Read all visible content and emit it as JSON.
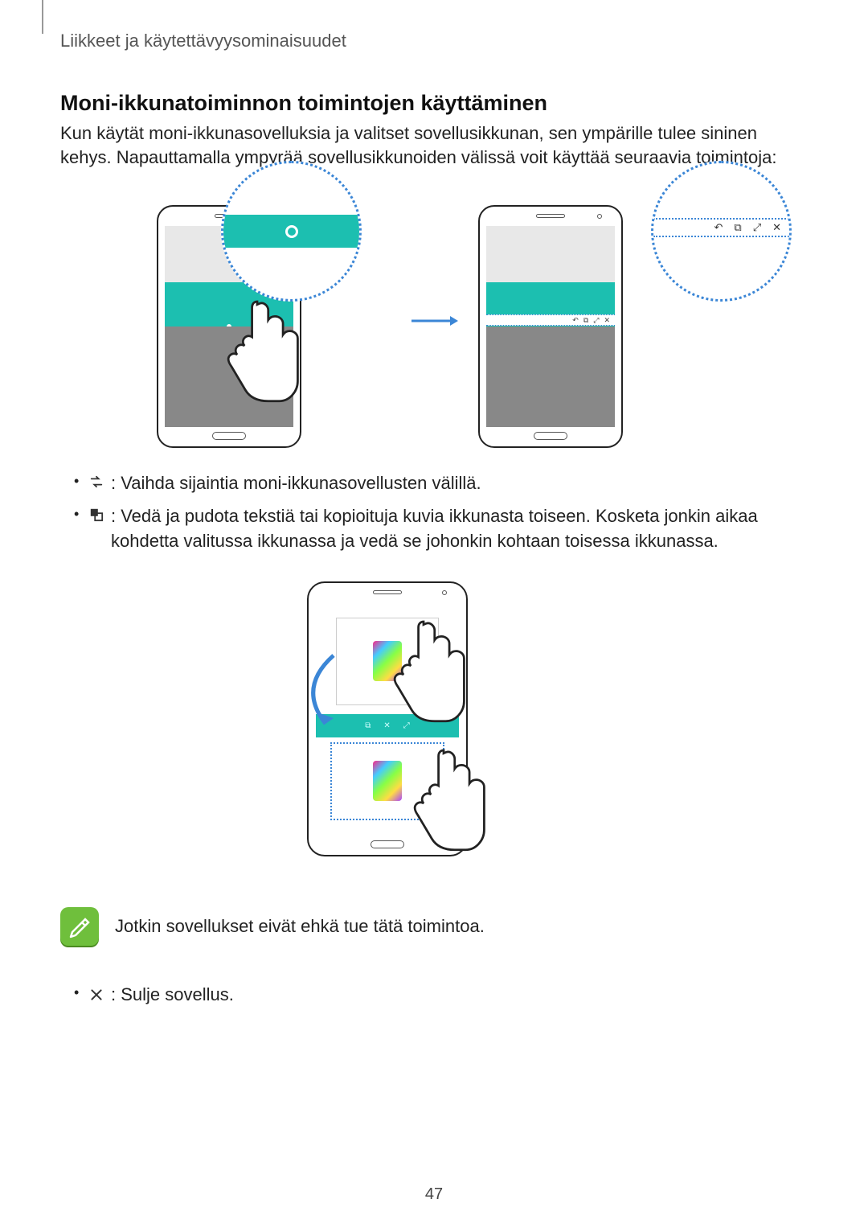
{
  "header": {
    "section": "Liikkeet ja käytettävyysominaisuudet"
  },
  "title": "Moni-ikkunatoiminnon toimintojen käyttäminen",
  "intro": "Kun käytät moni-ikkunasovelluksia ja valitset sovellusikkunan, sen ympärille tulee sininen kehys. Napauttamalla ympyrää sovellusikkunoiden välissä voit käyttää seuraavia toimintoja:",
  "bullets": [
    {
      "icon": "swap",
      "text": ": Vaihda sijaintia moni-ikkunasovellusten välillä."
    },
    {
      "icon": "drag-drop",
      "text": ": Vedä ja pudota tekstiä tai kopioituja kuvia ikkunasta toiseen. Kosketa jonkin aikaa kohdetta valitussa ikkunassa ja vedä se johonkin kohtaan toisessa ikkunassa."
    }
  ],
  "note": {
    "text": "Jotkin sovellukset eivät ehkä tue tätä toimintoa."
  },
  "final_bullets": [
    {
      "icon": "close",
      "text": ": Sulje sovellus."
    }
  ],
  "page_number": "47",
  "mw_toolbar_icons": [
    "↶",
    "⧉",
    "⤢",
    "✕"
  ]
}
